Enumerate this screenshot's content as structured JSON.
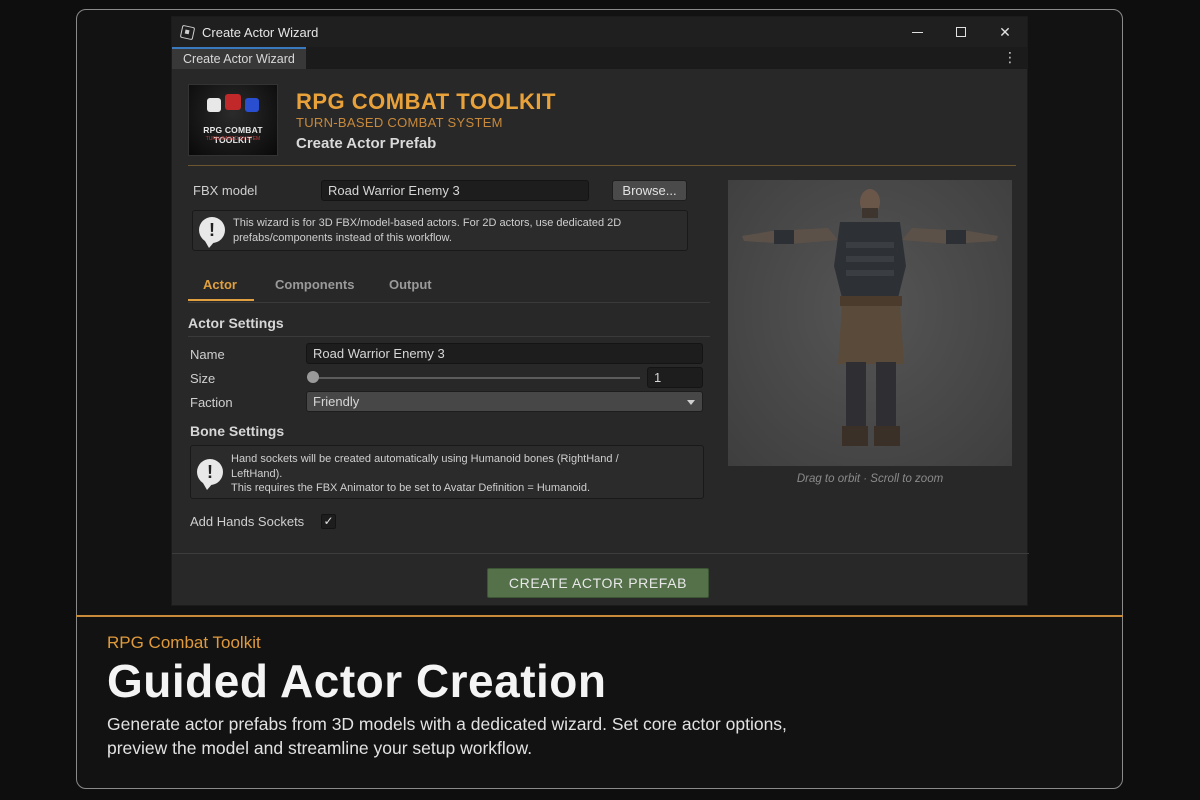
{
  "window": {
    "title": "Create Actor Wizard",
    "tab_label": "Create Actor Wizard",
    "controls": {
      "minimize": "minimize-icon",
      "maximize": "maximize-icon",
      "close": "✕"
    },
    "menu_glyph": "⋮"
  },
  "header": {
    "logo_text": "RPG COMBAT TOOLKIT",
    "logo_subtext": "TURN-BASED SYSTEM",
    "title": "RPG COMBAT TOOLKIT",
    "subtitle": "TURN-BASED COMBAT SYSTEM",
    "heading": "Create Actor Prefab"
  },
  "fbx": {
    "label": "FBX model",
    "value": "Road Warrior Enemy 3",
    "browse_label": "Browse...",
    "help": "This wizard is for 3D FBX/model-based actors. For 2D actors, use dedicated 2D prefabs/components instead of this workflow."
  },
  "tabs": [
    {
      "label": "Actor",
      "active": true
    },
    {
      "label": "Components",
      "active": false
    },
    {
      "label": "Output",
      "active": false
    }
  ],
  "actor_settings": {
    "heading": "Actor Settings",
    "name_label": "Name",
    "name_value": "Road Warrior Enemy 3",
    "size_label": "Size",
    "size_value": "1",
    "size_slider_fraction": 0,
    "faction_label": "Faction",
    "faction_value": "Friendly"
  },
  "bone_settings": {
    "heading": "Bone Settings",
    "help_line1": "Hand sockets will be created automatically using Humanoid bones (RightHand /",
    "help_line2": "LeftHand).",
    "help_line3": "This requires the FBX Animator to be set to Avatar Definition = Humanoid.",
    "hands_label": "Add Hands Sockets",
    "hands_checked": true,
    "check_glyph": "✓"
  },
  "preview": {
    "hint": "Drag to orbit · Scroll to zoom"
  },
  "footer": {
    "create_label": "CREATE ACTOR PREFAB"
  },
  "caption": {
    "kicker": "RPG Combat Toolkit",
    "title": "Guided Actor Creation",
    "body": "Generate actor prefabs from 3D models with a dedicated wizard. Set core actor options, preview the model and streamline your setup workflow."
  },
  "colors": {
    "accent": "#e9a13a",
    "create_button": "#54714a",
    "frame_divider": "#c88b3a"
  }
}
